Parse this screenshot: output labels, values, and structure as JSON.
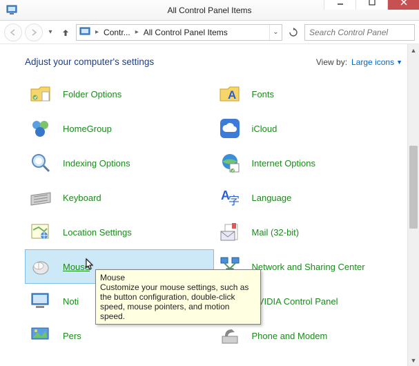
{
  "window": {
    "title": "All Control Panel Items",
    "breadcrumb": {
      "seg1": "Contr...",
      "seg2": "All Control Panel Items"
    },
    "search_placeholder": "Search Control Panel"
  },
  "header": {
    "heading": "Adjust your computer's settings",
    "viewby_label": "View by:",
    "viewby_value": "Large icons"
  },
  "items": [
    {
      "label": "Folder Options"
    },
    {
      "label": "Fonts"
    },
    {
      "label": "HomeGroup"
    },
    {
      "label": "iCloud"
    },
    {
      "label": "Indexing Options"
    },
    {
      "label": "Internet Options"
    },
    {
      "label": "Keyboard"
    },
    {
      "label": "Language"
    },
    {
      "label": "Location Settings"
    },
    {
      "label": "Mail (32-bit)"
    },
    {
      "label": "Mouse"
    },
    {
      "label": "Network and Sharing Center"
    },
    {
      "label": "Noti"
    },
    {
      "label": "NVIDIA Control Panel"
    },
    {
      "label": "Pers"
    },
    {
      "label": "Phone and Modem"
    }
  ],
  "tooltip": {
    "title": "Mouse",
    "body": "Customize your mouse settings, such as the button configuration, double-click speed, mouse pointers, and motion speed."
  }
}
